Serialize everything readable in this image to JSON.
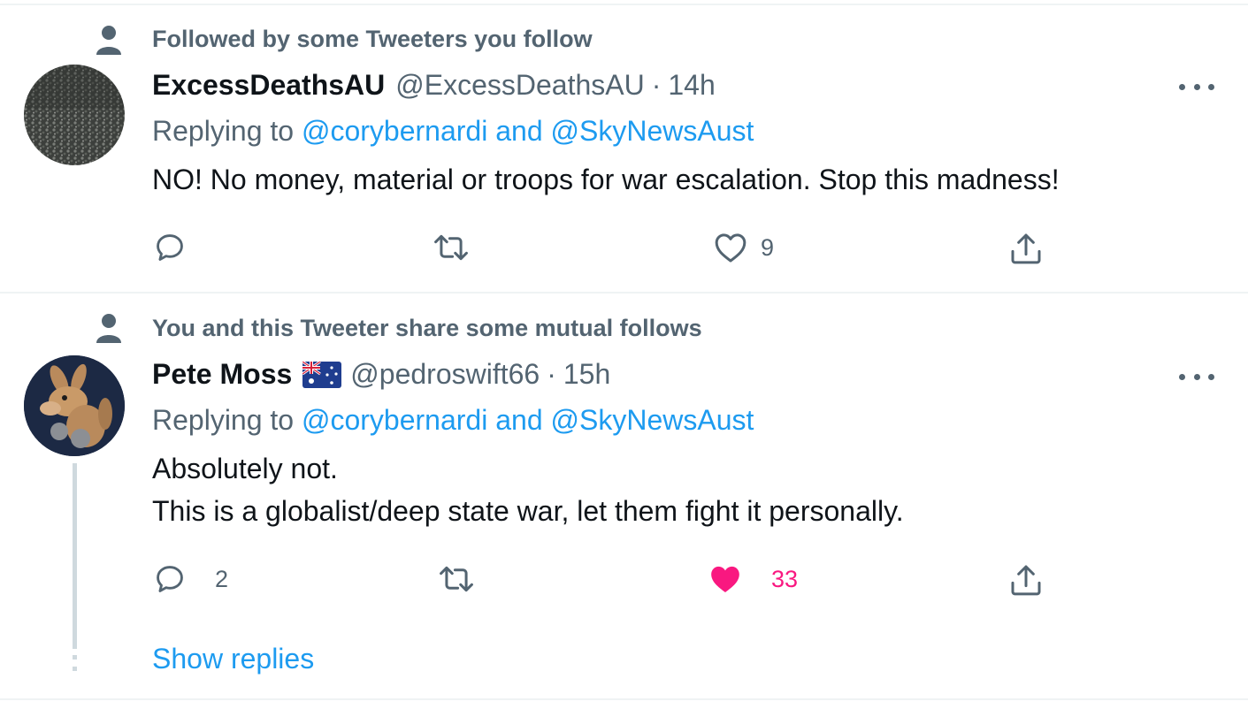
{
  "tweets": [
    {
      "social_context": "Followed by some Tweeters you follow",
      "display_name": "ExcessDeathsAU",
      "handle": "@ExcessDeathsAU",
      "separator": "·",
      "time": "14h",
      "replying_prefix": "Replying to",
      "replying_users": "@corybernardi and @SkyNewsAust",
      "text_lines": [
        "NO! No money, material or troops for war escalation. Stop this madness!"
      ],
      "reply_count": "",
      "retweet_count": "",
      "like_count": "9",
      "liked": false
    },
    {
      "social_context": "You and this Tweeter share some mutual follows",
      "display_name": "Pete Moss",
      "flag_icon": "australia-flag-icon",
      "handle": "@pedroswift66",
      "separator": "·",
      "time": "15h",
      "replying_prefix": "Replying to",
      "replying_users": "@corybernardi and @SkyNewsAust",
      "text_lines": [
        "Absolutely not.",
        "This is a globalist/deep state war, let them fight it personally."
      ],
      "reply_count": "2",
      "retweet_count": "",
      "like_count": "33",
      "liked": true
    }
  ],
  "show_replies_label": "Show replies",
  "colors": {
    "link": "#1d9bf0",
    "secondary": "#536471",
    "like": "#f91880",
    "divider": "#eff3f4"
  },
  "icons": [
    "person-icon",
    "more-icon",
    "reply-icon",
    "retweet-icon",
    "like-icon",
    "share-icon"
  ]
}
